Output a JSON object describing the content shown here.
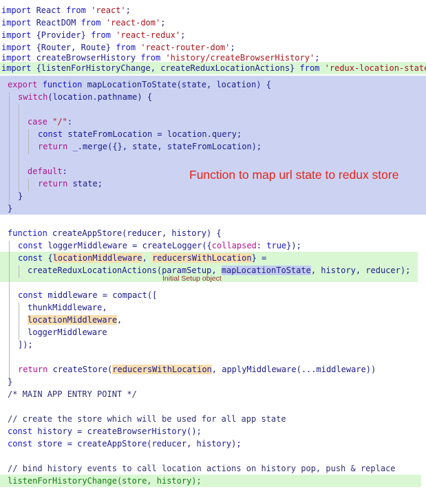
{
  "code": {
    "l1": [
      "import",
      " React ",
      "from",
      " ",
      "'react'",
      ";"
    ],
    "l2": [
      "import",
      " ReactDOM ",
      "from",
      " ",
      "'react-dom'",
      ";"
    ],
    "l3": [
      "import",
      " {Provider} ",
      "from",
      " ",
      "'react-redux'",
      ";"
    ],
    "l4": [
      "import",
      " {Router, Route} ",
      "from",
      " ",
      "'react-router-dom'",
      ";"
    ],
    "l5": [
      "import",
      " createBrowserHistory ",
      "from",
      " ",
      "'history/createBrowserHistory'",
      ";"
    ],
    "l6": [
      "import",
      " {listenForHistoryChange, createReduxLocationActions} ",
      "from",
      " ",
      "'redux-location-state'",
      ";"
    ],
    "l7": [
      "export",
      " ",
      "function",
      " mapLocationToState(state, location) {"
    ],
    "l8": [
      "switch",
      "(location.pathname) {"
    ],
    "l9": [
      "case",
      " ",
      "\"/\"",
      ":"
    ],
    "l10": [
      "const",
      " stateFromLocation = location.query;"
    ],
    "l11": [
      "return",
      " _.merge({}, state, stateFromLocation);"
    ],
    "l12": [
      "default",
      ":"
    ],
    "l13": [
      "return",
      " state;"
    ],
    "l14": "}",
    "l15": "}",
    "l16": [
      "function",
      " createAppStore(reducer, history) {"
    ],
    "l17": [
      "const",
      " loggerMiddleware = createLogger({",
      "collapsed",
      ": ",
      "true",
      "});"
    ],
    "l18": [
      "const",
      " {",
      "locationMiddleware",
      ", ",
      "reducersWithLocation",
      "} ="
    ],
    "l19": [
      "createReduxLocationActions(",
      "paramSetup",
      ", ",
      "mapLocationToState",
      ", history, reducer);"
    ],
    "l20": [
      "const",
      " middleware = compact(["
    ],
    "l21": "thunkMiddleware,",
    "l22": [
      "locationMiddleware",
      ","
    ],
    "l23": "loggerMiddleware",
    "l24": "]);",
    "l25": [
      "return",
      " createStore(",
      "reducersWithLocation",
      ", applyMiddleware(...middleware))"
    ],
    "l26": "}",
    "l27": "/* MAIN APP ENTRY POINT */",
    "l28": "// create the store which will be used for all app state",
    "l29": [
      "const",
      " history = createBrowserHistory();"
    ],
    "l30": [
      "const",
      " store = createAppStore(reducer, history);"
    ],
    "l31": "// bind history events to call location actions on history pop, push & replace",
    "l32": "listenForHistoryChange(store, history);"
  },
  "annotations": {
    "map_state": "Function to map url state to redux store",
    "setup": "Initial Setup object"
  },
  "colors": {
    "green_highlight": "#d9f7d3",
    "blue_block": "#ccd3f2",
    "orange_highlight": "#f9dfae",
    "annotation_red": "#e5241b"
  }
}
